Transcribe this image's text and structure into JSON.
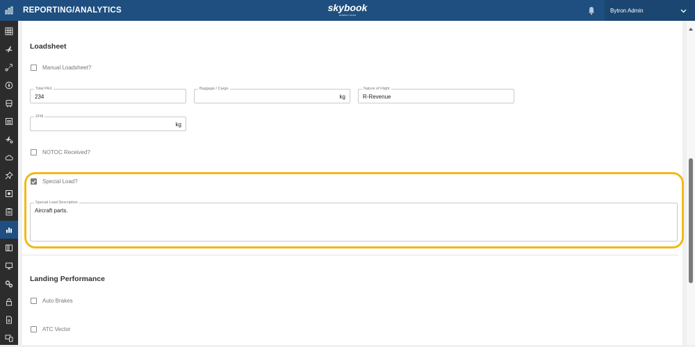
{
  "header": {
    "module_title": "REPORTING/ANALYTICS",
    "logo_text": "skybook",
    "logo_subtext": "aviation cloud",
    "user_name": "Bytron Admin"
  },
  "sidebar": {
    "items": [
      {
        "icon": "table-grid-icon"
      },
      {
        "icon": "plane-icon"
      },
      {
        "icon": "route-icon"
      },
      {
        "icon": "compass-icon"
      },
      {
        "icon": "bus-icon"
      },
      {
        "icon": "calendar-list-icon"
      },
      {
        "icon": "plane-tools-icon"
      },
      {
        "icon": "weather-icon"
      },
      {
        "icon": "pushpin-icon"
      },
      {
        "icon": "certificate-icon"
      },
      {
        "icon": "clipboard-icon"
      },
      {
        "icon": "bar-chart-icon",
        "active": true
      },
      {
        "icon": "book-icon"
      },
      {
        "icon": "monitor-icon"
      },
      {
        "icon": "gears-icon"
      },
      {
        "icon": "lock-icon"
      },
      {
        "icon": "document-icon"
      },
      {
        "icon": "devices-icon"
      }
    ]
  },
  "loadsheet": {
    "title": "Loadsheet",
    "manual_loadsheet": {
      "label": "Manual Loadsheet?",
      "checked": false
    },
    "total_pax": {
      "label": "Total PAX",
      "value": "234"
    },
    "baggage_cargo": {
      "label": "Baggage / Cargo",
      "value": "",
      "unit": "kg"
    },
    "nature_of_flight": {
      "label": "Nature of Flight",
      "value": "R-Revenue"
    },
    "zfm": {
      "label": "ZFM",
      "value": "",
      "unit": "kg"
    },
    "notoc_received": {
      "label": "NOTOC Received?",
      "checked": false
    },
    "special_load": {
      "label": "Special Load?",
      "checked": true
    },
    "special_load_description": {
      "label": "Special Load Description",
      "value": "Aircraft parts."
    }
  },
  "landing_performance": {
    "title": "Landing Performance",
    "auto_brakes": {
      "label": "Auto Brakes",
      "checked": false
    },
    "atc_vector": {
      "label": "ATC Vector",
      "checked": false
    }
  },
  "colors": {
    "header_blue": "#1e4f80",
    "sidebar_dark": "#2c2c2c",
    "highlight_yellow": "#f2b817"
  }
}
